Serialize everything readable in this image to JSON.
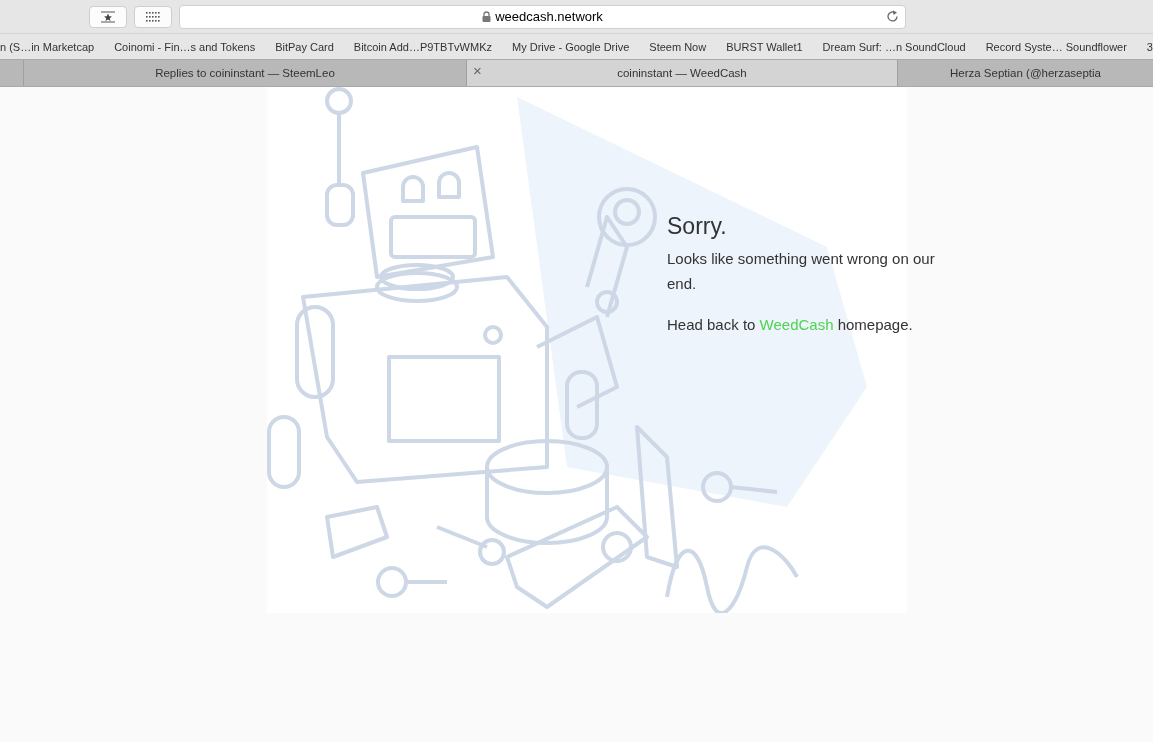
{
  "toolbar": {
    "address": "weedcash.network"
  },
  "bookmarks": [
    "n (S…in Marketcap",
    "Coinomi - Fin…s and Tokens",
    "BitPay Card",
    "Bitcoin Add…P9TBTvWMKz",
    "My Drive - Google Drive",
    "Steem Now",
    "BURST Wallet1",
    "Dream Surf: …n SoundCloud",
    "Record Syste… Soundflower",
    "3"
  ],
  "tabs": [
    {
      "title": "Replies to coininstant — SteemLeo",
      "selected": false
    },
    {
      "title": "coininstant — WeedCash",
      "selected": true,
      "close": "×"
    },
    {
      "title": "Herza Septian (@herzaseptia",
      "selected": false
    }
  ],
  "error": {
    "heading": "Sorry.",
    "message": "Looks like something went wrong on our end.",
    "link_before": "Head back to ",
    "link": "WeedCash",
    "link_after": " homepage."
  }
}
